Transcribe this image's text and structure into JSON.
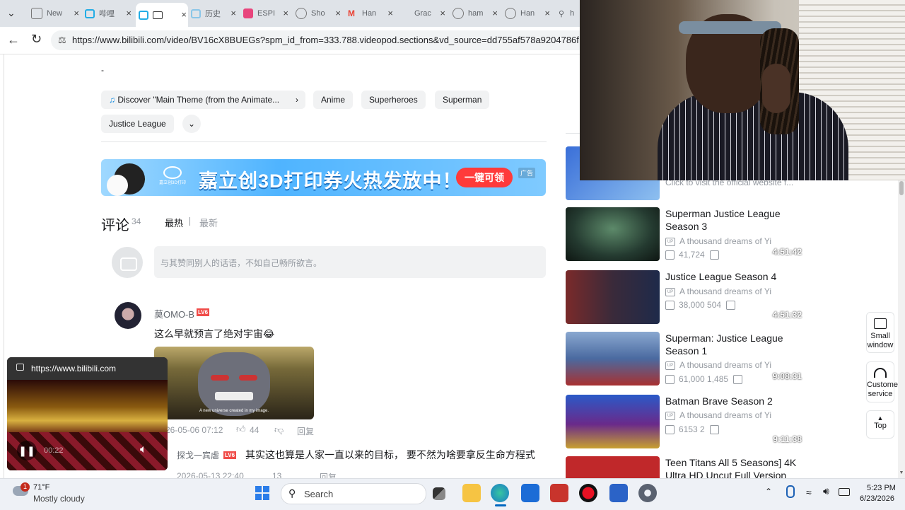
{
  "browser": {
    "tabs": [
      {
        "label": "New",
        "color": "#8ab4f8"
      },
      {
        "label": "哔哩",
        "color": "#23ade5"
      },
      {
        "label": "",
        "color": "#23ade5"
      },
      {
        "label": "历史",
        "color": "#23ade5"
      },
      {
        "label": "ESPI",
        "color": "#e8457c"
      },
      {
        "label": "Sho",
        "color": "#9aa0a6"
      },
      {
        "label": "Han",
        "color": "#ea4335"
      },
      {
        "label": "Grac",
        "color": "#9aa0a6"
      },
      {
        "label": "ham",
        "color": "#9aa0a6"
      },
      {
        "label": "Han",
        "color": "#9aa0a6"
      },
      {
        "label": "h",
        "color": "#9aa0a6"
      }
    ],
    "url": "https://www.bilibili.com/video/BV16cX8BUEGs?spm_id_from=333.788.videopod.sections&vd_source=dd755af578a9204786f"
  },
  "tags": {
    "music": "Discover \"Main Theme (from the Animate...",
    "items": [
      "Anime",
      "Superheroes",
      "Superman",
      "Justice League"
    ]
  },
  "ad": {
    "text": "嘉立创3D打印券火热发放中！",
    "button": "一键可领",
    "badge": "广告",
    "logo": "嘉立创3D打印"
  },
  "comments": {
    "title": "评论",
    "count": "34",
    "sort_hot": "最热",
    "sort_new": "最新",
    "placeholder": "与其赞同别人的话语，不如自己畅所欲言。",
    "list": [
      {
        "user": "莫OMO-B",
        "level": "LV6",
        "text": "这么早就预言了绝对宇宙",
        "emoji": "😂",
        "image_caption": "A new universe created in my image.",
        "date": "26-05-06 07:12",
        "likes": "44",
        "reply": "回复"
      },
      {
        "user": "探戈一宾虐",
        "level": "LV6",
        "text": "其实这也算是人家一直以来的目标， 要不然为啥要拿反生命方程式",
        "date": "2026-05-13 22:40",
        "likes": "13",
        "reply": "回复"
      }
    ]
  },
  "recommendations": [
    {
      "title": "",
      "uploader": "Click to visit the official website f...",
      "duration": "",
      "views": "",
      "danmaku": "",
      "color": "#3a6fd8"
    },
    {
      "title": "Superman Justice League Season 3",
      "uploader": "A thousand dreams of Yi",
      "duration": "4:51:42",
      "views": "41,724",
      "danmaku": "",
      "color": "#2c4a3a"
    },
    {
      "title": "Justice League Season 4",
      "uploader": "A thousand dreams of Yi",
      "duration": "4:51:32",
      "views": "38,000",
      "danmaku": "504",
      "color": "#5a2a2a"
    },
    {
      "title": "Superman: Justice League Season 1",
      "uploader": "A thousand dreams of Yi",
      "duration": "9:08:31",
      "views": "61,000",
      "danmaku": "1,485",
      "color": "#4a6aa0"
    },
    {
      "title": "Batman Brave Season 2",
      "uploader": "A thousand dreams of Yi",
      "duration": "9:11:38",
      "views": "6153",
      "danmaku": "2",
      "color": "#6a2a8a"
    },
    {
      "title": "Teen Titans All 5 Seasons] 4K Ultra HD Uncut Full Version",
      "uploader": "",
      "duration": "",
      "views": "",
      "danmaku": "",
      "color": "#c0282a"
    }
  ],
  "side_buttons": {
    "small_window": "Small window",
    "customer_service": "Customer service",
    "top": "Top"
  },
  "mini_player": {
    "url": "https://www.bilibili.com",
    "time": "00:22"
  },
  "taskbar": {
    "weather_temp": "71°F",
    "weather_desc": "Mostly cloudy",
    "weather_badge": "1",
    "search": "Search",
    "time": "5:23 PM",
    "date": "6/23/2026"
  }
}
